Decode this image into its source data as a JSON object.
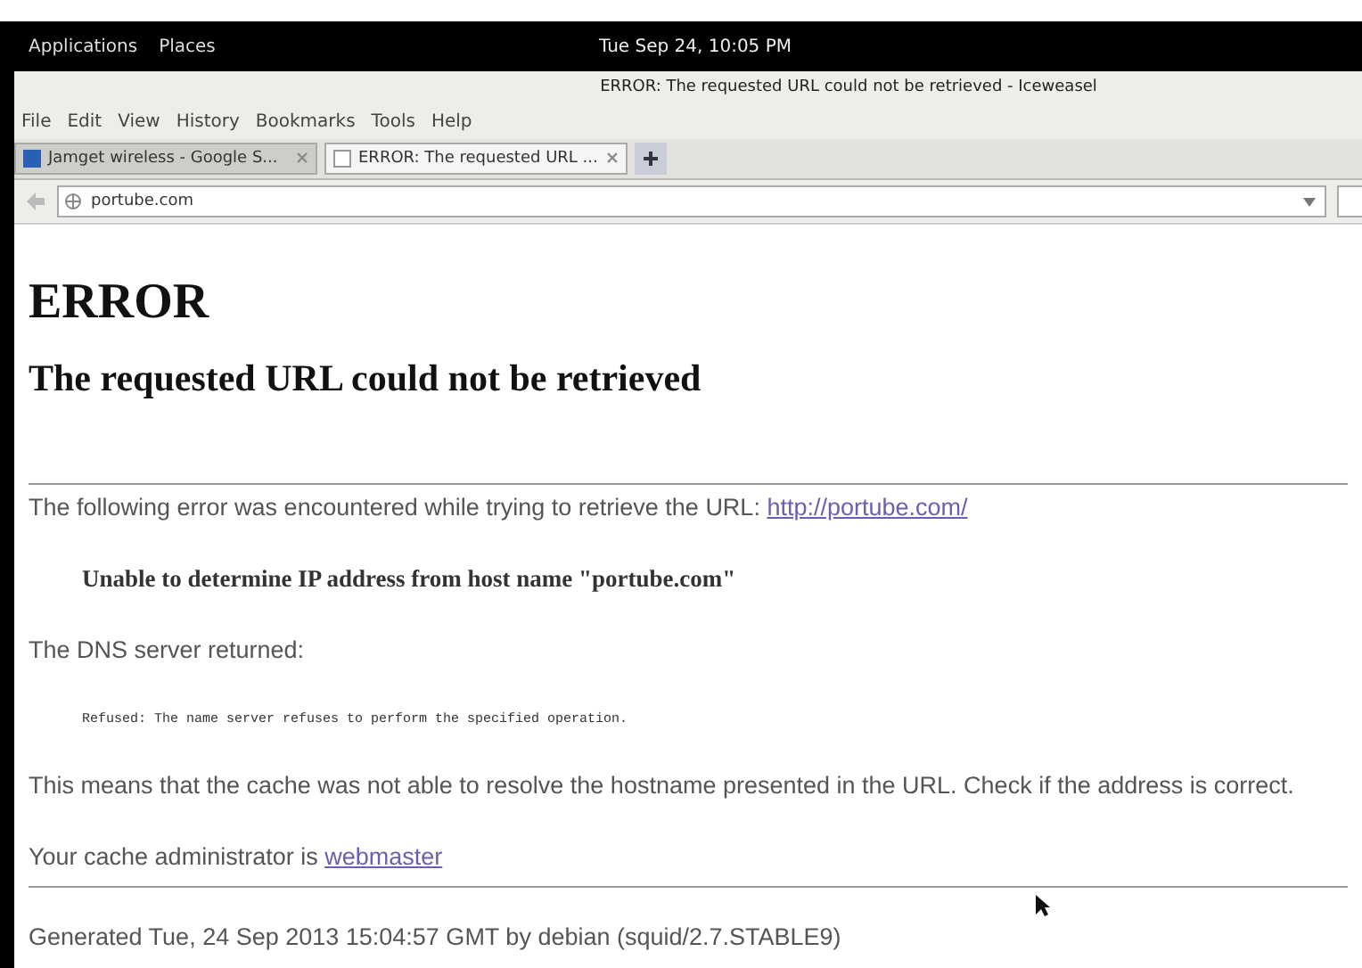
{
  "top_panel": {
    "menus": [
      "Applications",
      "Places"
    ],
    "clock": "Tue Sep 24, 10:05 PM"
  },
  "window": {
    "title": "ERROR: The requested URL could not be retrieved - Iceweasel"
  },
  "menu_bar": [
    "File",
    "Edit",
    "View",
    "History",
    "Bookmarks",
    "Tools",
    "Help"
  ],
  "tabs": [
    {
      "label": "Jamget wireless - Google S...",
      "selected": false
    },
    {
      "label": "ERROR: The requested URL ...",
      "selected": true
    }
  ],
  "address_bar": {
    "value": "portube.com"
  },
  "page": {
    "heading": "ERROR",
    "subheading": "The requested URL could not be retrieved",
    "intro": "The following error was encountered while trying to retrieve the URL: ",
    "intro_link": "http://portube.com/",
    "error_message": "Unable to determine IP address from host name \"portube.com\"",
    "dns_label": "The DNS server returned:",
    "dns_detail": "Refused: The name server refuses to perform the specified operation.",
    "explanation": "This means that the cache was not able to resolve the hostname presented in the URL. Check if the address is correct.",
    "admin_text": "Your cache administrator is ",
    "admin_link": "webmaster",
    "footer": "Generated Tue, 24 Sep 2013 15:04:57 GMT by debian (squid/2.7.STABLE9)"
  }
}
